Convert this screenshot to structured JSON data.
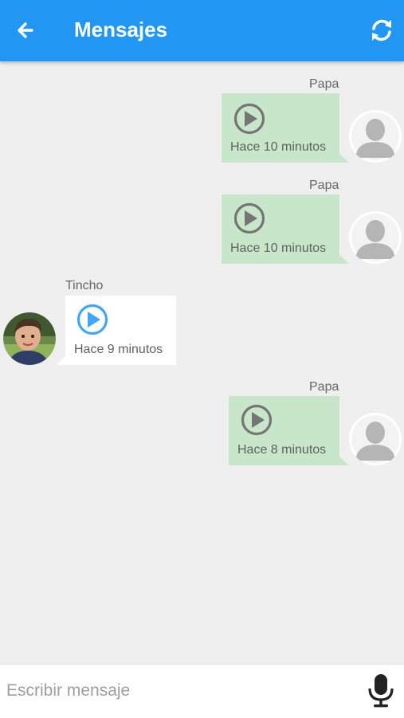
{
  "appbar": {
    "title": "Mensajes",
    "back_icon": "arrow-left-icon",
    "refresh_icon": "refresh-icon",
    "color": "#2196f3"
  },
  "messages": [
    {
      "sender": "Papa",
      "time": "Hace 10 minutos",
      "side": "right",
      "icon": "play-icon"
    },
    {
      "sender": "Papa",
      "time": "Hace 10 minutos",
      "side": "right",
      "icon": "play-icon"
    },
    {
      "sender": "Tincho",
      "time": "Hace 9 minutos",
      "side": "left",
      "icon": "play-icon"
    },
    {
      "sender": "Papa",
      "time": "Hace 8 minutos",
      "side": "right",
      "icon": "play-icon"
    }
  ],
  "colors": {
    "outgoing_bubble": "#c8e6c9",
    "incoming_bubble": "#ffffff",
    "incoming_play": "#42a5f5",
    "outgoing_play": "#757575"
  },
  "composer": {
    "placeholder": "Escribir mensaje",
    "mic_icon": "microphone-icon"
  }
}
